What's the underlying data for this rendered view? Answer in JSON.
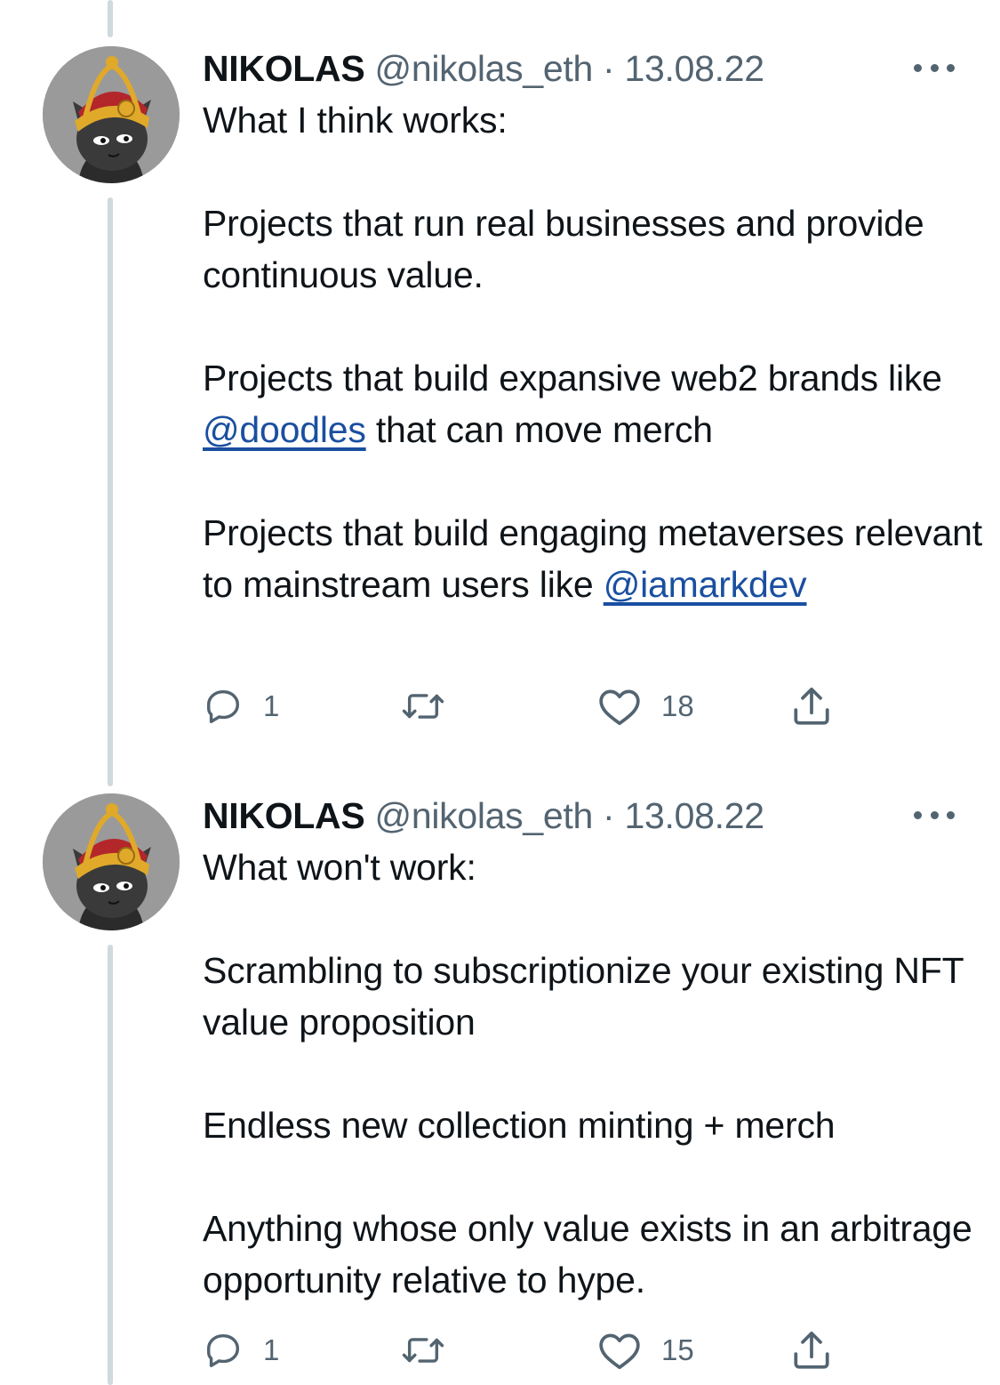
{
  "tweets": [
    {
      "name": "NIKOLAS",
      "handle": "@nikolas_eth",
      "separator": "·",
      "date": "13.08.22",
      "paragraphs": [
        [
          {
            "text": "What I think works:"
          }
        ],
        [
          {
            "text": "Projects that run real businesses and provide continuous value."
          }
        ],
        [
          {
            "text": "Projects that build expansive web2 brands like "
          },
          {
            "text": "@doodles",
            "mention": true
          },
          {
            "text": " that can move merch"
          }
        ],
        [
          {
            "text": "Projects that build engaging metaverses relevant to mainstream users like "
          },
          {
            "text": "@iamarkdev",
            "mention": true
          }
        ]
      ],
      "replies": "1",
      "retweets": "",
      "likes": "18"
    },
    {
      "name": "NIKOLAS",
      "handle": "@nikolas_eth",
      "separator": "·",
      "date": "13.08.22",
      "paragraphs": [
        [
          {
            "text": "What won't work:"
          }
        ],
        [
          {
            "text": "Scrambling to subscriptionize your existing NFT value proposition"
          }
        ],
        [
          {
            "text": "Endless new collection minting + merch"
          }
        ],
        [
          {
            "text": "Anything whose only value exists in an arbitrage opportunity relative to hype."
          }
        ]
      ],
      "replies": "1",
      "retweets": "",
      "likes": "15"
    }
  ],
  "icons": {
    "reply": "reply-icon",
    "retweet": "retweet-icon",
    "like": "heart-icon",
    "share": "share-icon",
    "more": "more-icon"
  },
  "colors": {
    "text": "#0f1419",
    "secondary": "#536471",
    "mention": "#1a4fa0",
    "thread_line": "#cfd9de"
  }
}
